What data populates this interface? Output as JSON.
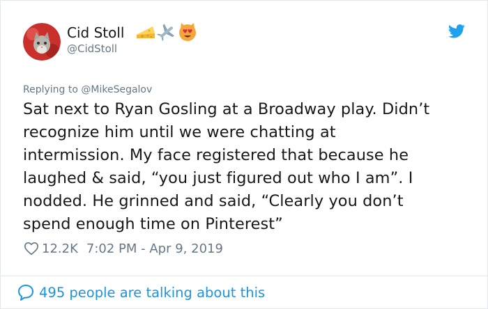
{
  "author": {
    "display_name": "Cid Stoll",
    "handle": "@CidStoll",
    "name_emojis": [
      "cheese-emoji",
      "airplane-emoji",
      "heart-eyes-cat-emoji"
    ]
  },
  "reply": {
    "prefix": "Replying to ",
    "mention": "@MikeSegalov"
  },
  "tweet": {
    "text": "Sat next to Ryan Gosling at a Broadway play. Didn’t\nrecognize him until we were chatting at\nintermission. My face registered that because he\nlaughed & said, “you just figured out who I am”. I\nnodded. He grinned and said, “Clearly you don’t\nspend enough time on Pinterest”"
  },
  "meta": {
    "likes": "12.2K",
    "timestamp": "7:02 PM - Apr 9, 2019"
  },
  "footer": {
    "talking": "495 people are talking about this"
  },
  "icons": {
    "brand": "twitter-bird-icon",
    "like": "heart-outline-icon",
    "reply": "speech-bubble-icon"
  },
  "colors": {
    "brand": "#1da1f2",
    "link": "#1b95e0",
    "muted": "#657786",
    "text": "#14171a",
    "border": "#e1e8ed"
  }
}
